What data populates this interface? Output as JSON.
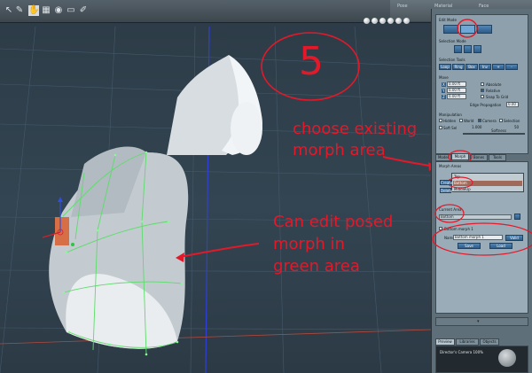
{
  "topbar": {
    "icons": [
      "pointer-icon",
      "brush-icon",
      "hand-icon",
      "stack-icon",
      "camera-icon",
      "lock-icon",
      "edit-icon"
    ],
    "tabs": [
      "Pose",
      "Material",
      "Face"
    ]
  },
  "panel": {
    "edit_mode_label": "Edit Mode",
    "selection_mode_label": "Selection Mode",
    "selection_tools_label": "Selection Tools",
    "selection_tools": [
      "Loop",
      "Ring",
      "Box",
      "Inv",
      "+",
      "-"
    ],
    "move_label": "Move",
    "move_x": "0.00 ft",
    "move_y": "0.00 ft",
    "move_z": "0.00 ft",
    "absolute_label": "Absolute",
    "relative_label": "Relative",
    "snap_label": "Snap To Grid",
    "edge_propagation_label": "Edge Propagation",
    "edge_propagation_value": "0.00",
    "manipulation_label": "Manipulation",
    "hidden_label": "Hidden",
    "world_label": "World",
    "camera_label": "Camera",
    "selection_label": "Selection",
    "soft_sel_label": "Soft Sel",
    "softness_value": "1.000",
    "softness_label": "Softness",
    "softness_right": "50",
    "tabs": [
      "Model",
      "Morph",
      "Bones",
      "Tools"
    ],
    "morph_areas_label": "Morph Areas",
    "morph_list": [
      "Top",
      "Bottom",
      "MiddleUp"
    ],
    "morph_selected_index": 1,
    "create_button": "Create",
    "delete_button": "Delete",
    "current_area_label": "Current Area",
    "current_area_value": "Bottom",
    "morph_name_check_label": "Bottom morph 1",
    "name_label": "Name",
    "morph_name_value": "Bottom morph 1",
    "valid_button": "Valid",
    "save_button": "Save",
    "load_button": "Load",
    "bottom_tabs": [
      "Preview",
      "Libraries",
      "Objects"
    ],
    "camera_readout": "Director's Camera 100%"
  },
  "annotations": {
    "step_number": "5",
    "arrow_text_line1": "choose existing",
    "arrow_text_line2": "morph area",
    "edit_text_line1": "Can edit posed",
    "edit_text_line2": "morph in",
    "edit_text_line3": "green area",
    "color": "#e3192a"
  },
  "colors": {
    "viewport_bg": "#2f404c",
    "panel_bg": "#5f6f7a",
    "mesh_highlight": "#5cdc6a",
    "annotation": "#e3192a"
  }
}
